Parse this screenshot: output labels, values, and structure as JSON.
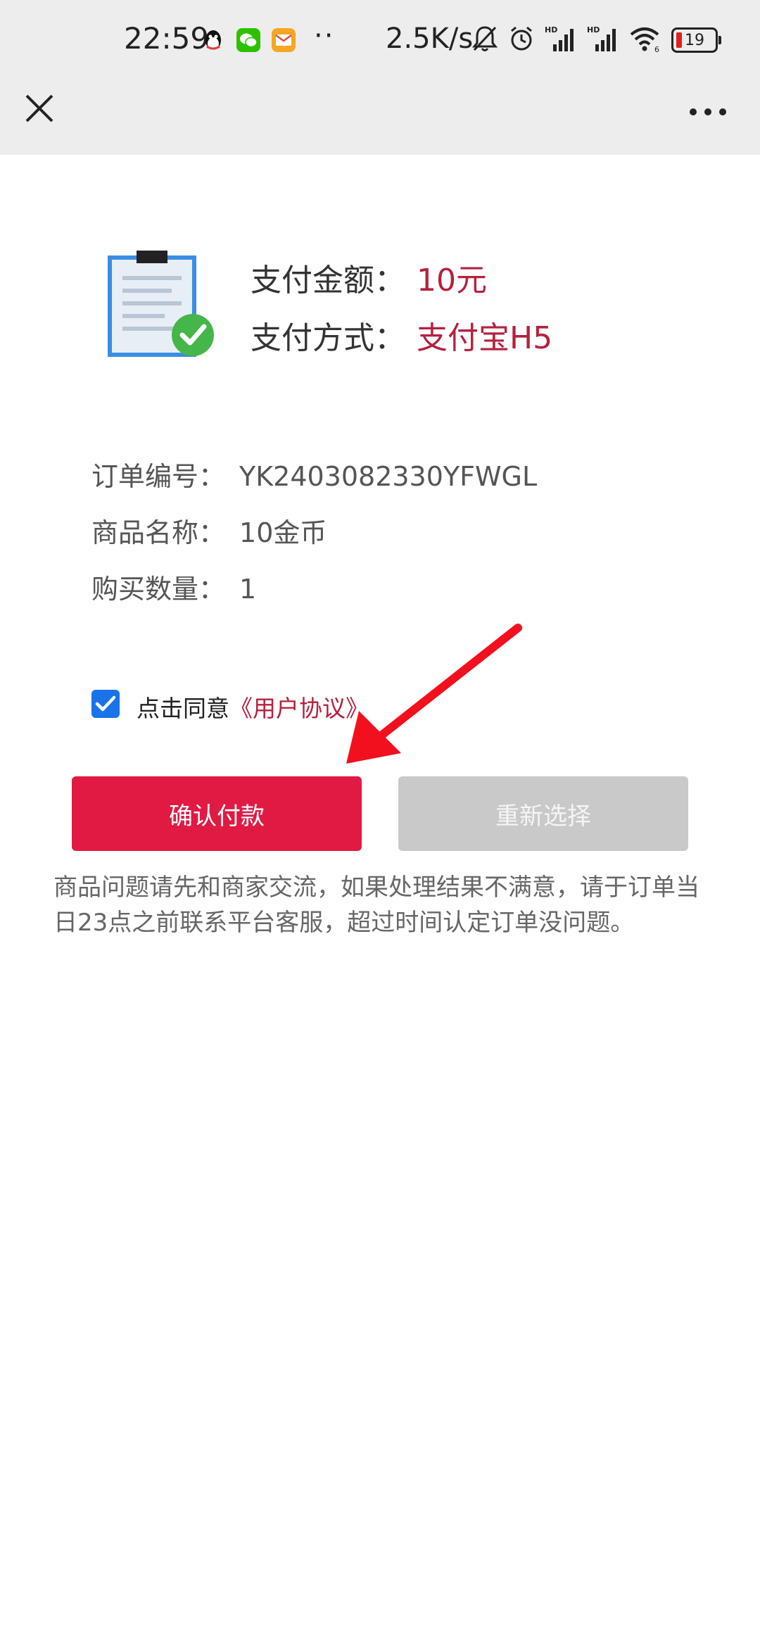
{
  "status_bar": {
    "time": "22:59",
    "dots": "··",
    "net_speed": "2.5K/s",
    "battery": "19"
  },
  "summary": {
    "amount_label": "支付金额：",
    "amount_value": "10元",
    "method_label": "支付方式：",
    "method_value": "支付宝H5"
  },
  "details": {
    "order_no_label": "订单编号：",
    "order_no_value": "YK2403082330YFWGL",
    "product_label": "商品名称：",
    "product_value": "10金币",
    "qty_label": "购买数量：",
    "qty_value": "1"
  },
  "agreement": {
    "text": "点击同意",
    "link": "《用户协议》",
    "checked": true
  },
  "buttons": {
    "confirm": "确认付款",
    "reselect": "重新选择"
  },
  "notice": "商品问题请先和商家交流，如果处理结果不满意，请于订单当日23点之前联系平台客服，超过时间认定订单没问题。",
  "colors": {
    "accent": "#e11a44",
    "value_text": "#b5213d",
    "checkbox": "#1a73e8",
    "disabled_button": "#c9c9c9",
    "arrow": "#f2101e"
  }
}
